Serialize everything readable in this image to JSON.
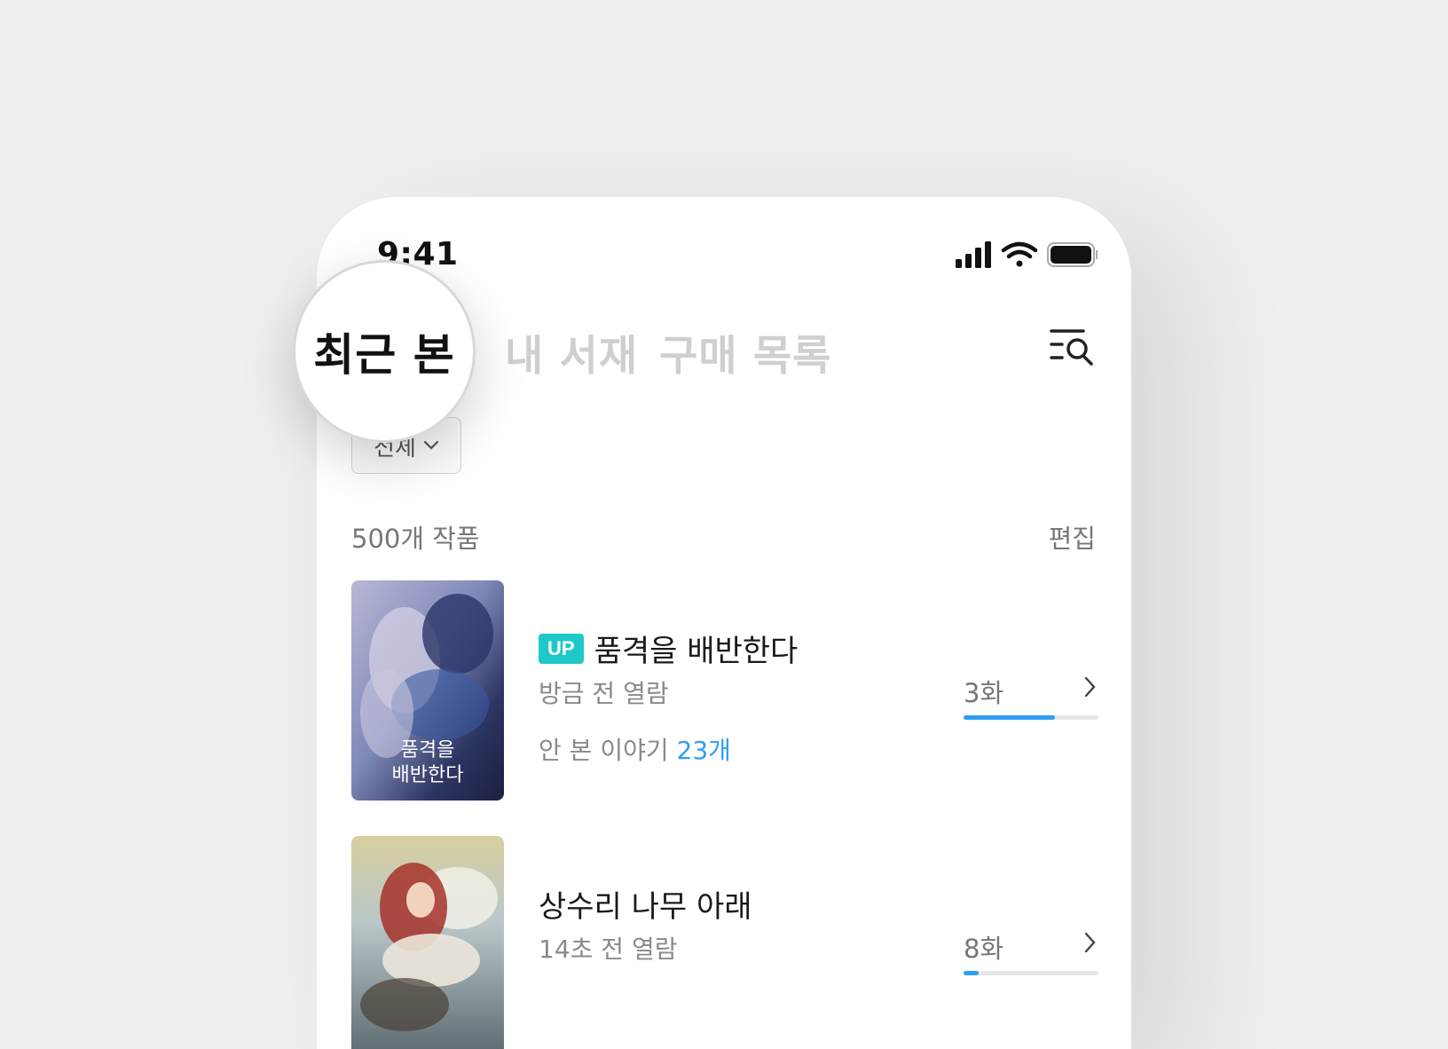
{
  "status_bar": {
    "time": "9:41"
  },
  "tabs": [
    {
      "label": "최근 본"
    },
    {
      "label": "내 서재"
    },
    {
      "label": "구매 목록"
    }
  ],
  "filter": {
    "selected": "전체"
  },
  "list_header": {
    "count_text": "500개 작품",
    "edit_label": "편집"
  },
  "items": [
    {
      "badge": "UP",
      "title": "품격을 배반한다",
      "viewed": "방금 전 열람",
      "unseen_prefix": "안 본 이야기",
      "unseen_count": "23개",
      "episode": "3화",
      "progress": 0.68,
      "cover_text": "품격을 배반한다"
    },
    {
      "title": "상수리 나무 아래",
      "viewed": "14초 전 열람",
      "episode": "8화",
      "progress": 0.11
    }
  ],
  "colors": {
    "accent_blue": "#2e9ef0",
    "badge_teal": "#1fc9c9"
  }
}
